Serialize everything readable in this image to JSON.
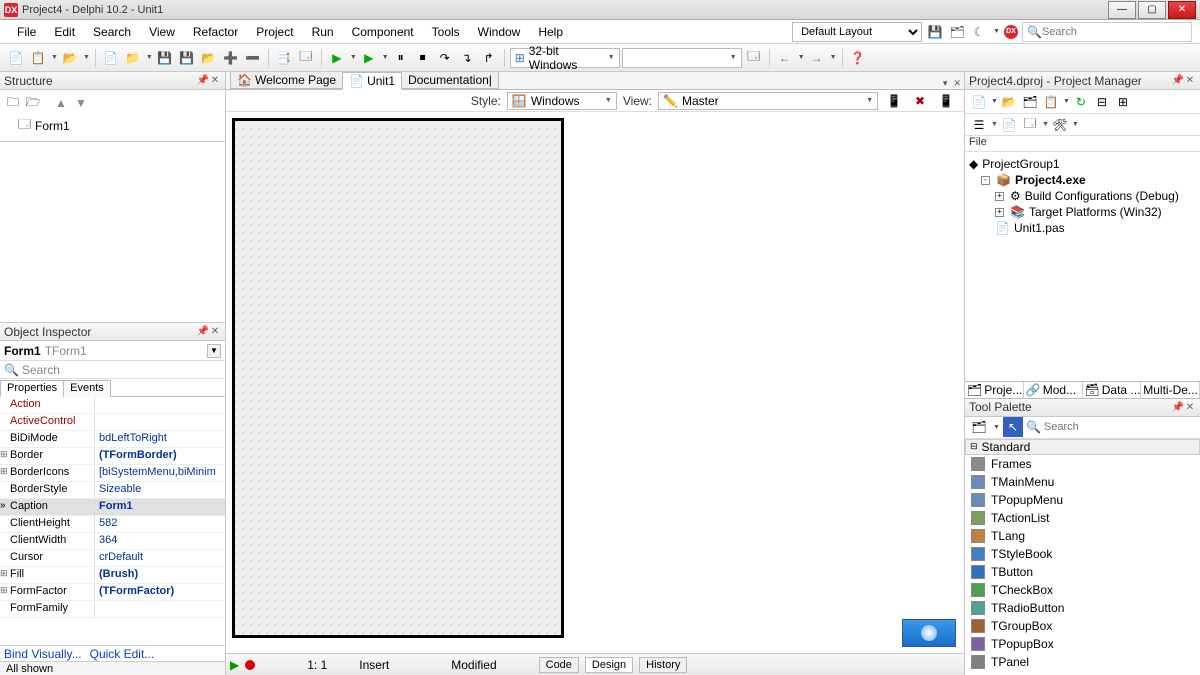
{
  "titlebar": {
    "icon_text": "DX",
    "text": "Project4 - Delphi 10.2 - Unit1"
  },
  "menubar": {
    "items": [
      "File",
      "Edit",
      "Search",
      "View",
      "Refactor",
      "Project",
      "Run",
      "Component",
      "Tools",
      "Window",
      "Help"
    ],
    "layout": "Default Layout",
    "search_placeholder": "Search"
  },
  "toolbar": {
    "platform": "32-bit Windows"
  },
  "structure": {
    "title": "Structure",
    "root": "Form1"
  },
  "object_inspector": {
    "title": "Object Inspector",
    "object_name": "Form1",
    "object_type": "TForm1",
    "search_placeholder": "Search",
    "tabs": [
      "Properties",
      "Events"
    ],
    "props": [
      {
        "name": "Action",
        "val": "",
        "red": true
      },
      {
        "name": "ActiveControl",
        "val": "",
        "red": true
      },
      {
        "name": "BiDiMode",
        "val": "bdLeftToRight"
      },
      {
        "name": "Border",
        "val": "(TFormBorder)",
        "exp": true,
        "bold": true
      },
      {
        "name": "BorderIcons",
        "val": "[biSystemMenu,biMinim",
        "exp": true
      },
      {
        "name": "BorderStyle",
        "val": "Sizeable"
      },
      {
        "name": "Caption",
        "val": "Form1",
        "sel": true,
        "bold": true,
        "mark": true
      },
      {
        "name": "ClientHeight",
        "val": "582"
      },
      {
        "name": "ClientWidth",
        "val": "364"
      },
      {
        "name": "Cursor",
        "val": "crDefault"
      },
      {
        "name": "Fill",
        "val": "(Brush)",
        "exp": true,
        "bold": true
      },
      {
        "name": "FormFactor",
        "val": "(TFormFactor)",
        "exp": true,
        "bold": true
      },
      {
        "name": "FormFamily",
        "val": ""
      }
    ],
    "footer": [
      "Bind Visually...",
      "Quick Edit..."
    ]
  },
  "center": {
    "tabs": [
      {
        "label": "Welcome Page",
        "active": false
      },
      {
        "label": "Unit1",
        "active": true
      },
      {
        "label": "Documentation|",
        "active": false
      }
    ],
    "style_label": "Style:",
    "style_value": "Windows",
    "view_label": "View:",
    "view_value": "Master",
    "status_pos": "1: 1",
    "status_mode": "Insert",
    "status_modified": "Modified",
    "view_tabs": [
      "Code",
      "Design",
      "History"
    ]
  },
  "project_manager": {
    "title": "Project4.dproj - Project Manager",
    "file_label": "File",
    "tree": [
      {
        "label": "ProjectGroup1",
        "depth": 0,
        "icon": "grp"
      },
      {
        "label": "Project4.exe",
        "depth": 1,
        "icon": "exe",
        "bold": true,
        "exp": "-"
      },
      {
        "label": "Build Configurations (Debug)",
        "depth": 2,
        "icon": "cfg",
        "exp": "+"
      },
      {
        "label": "Target Platforms (Win32)",
        "depth": 2,
        "icon": "tgt",
        "exp": "+"
      },
      {
        "label": "Unit1.pas",
        "depth": 2,
        "icon": "pas"
      }
    ],
    "bottom_tabs": [
      "Proje...",
      "Mod...",
      "Data ...",
      "Multi-De..."
    ]
  },
  "tool_palette": {
    "title": "Tool Palette",
    "search_placeholder": "Search",
    "category": "Standard",
    "items": [
      {
        "label": "Frames",
        "color": "#8a8a8a"
      },
      {
        "label": "TMainMenu",
        "color": "#6a8aba"
      },
      {
        "label": "TPopupMenu",
        "color": "#6a8aba"
      },
      {
        "label": "TActionList",
        "color": "#7aa060"
      },
      {
        "label": "TLang",
        "color": "#c08040"
      },
      {
        "label": "TStyleBook",
        "color": "#4080c0"
      },
      {
        "label": "TButton",
        "color": "#3070c0"
      },
      {
        "label": "TCheckBox",
        "color": "#50a050"
      },
      {
        "label": "TRadioButton",
        "color": "#50a090"
      },
      {
        "label": "TGroupBox",
        "color": "#a06030"
      },
      {
        "label": "TPopupBox",
        "color": "#8060a0"
      },
      {
        "label": "TPanel",
        "color": "#808080"
      }
    ]
  },
  "bottom_status": "All shown"
}
